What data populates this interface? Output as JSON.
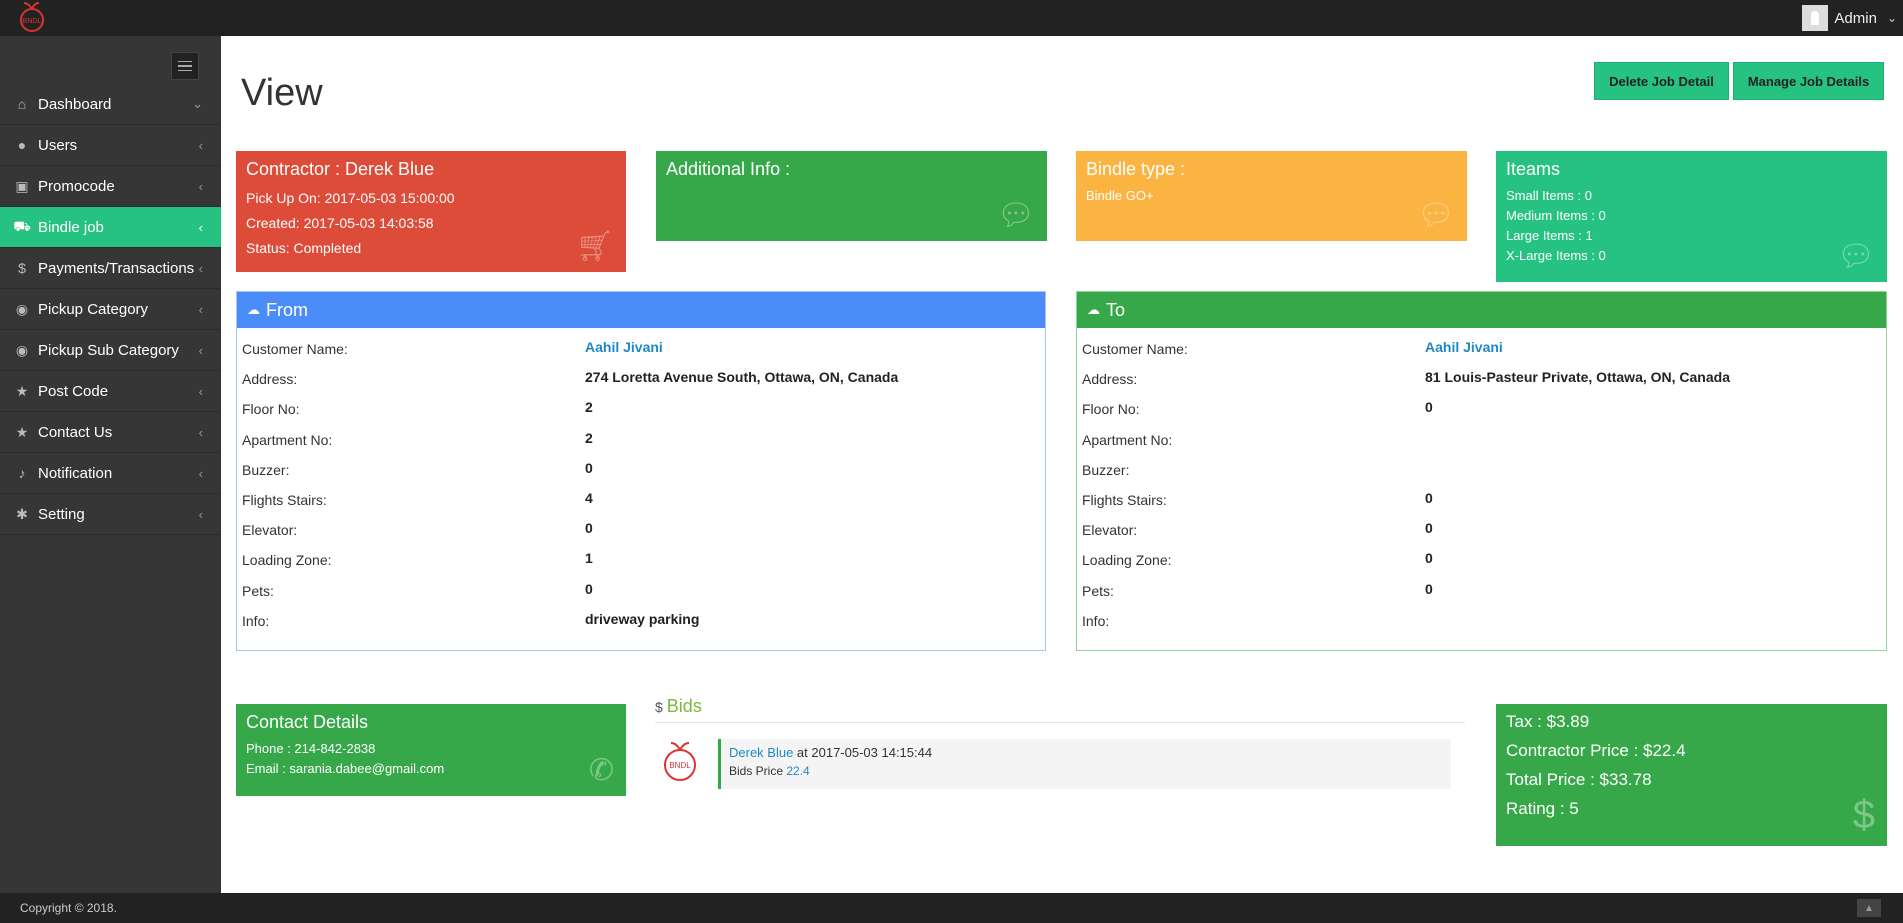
{
  "header": {
    "user": "Admin"
  },
  "sidebar": {
    "items": [
      {
        "icon": "home-icon",
        "glyph": "⌂",
        "label": "Dashboard",
        "arrow": "⌄"
      },
      {
        "icon": "user-icon",
        "glyph": "●",
        "label": "Users",
        "arrow": "‹"
      },
      {
        "icon": "gift-icon",
        "glyph": "▣",
        "label": "Promocode",
        "arrow": "‹"
      },
      {
        "icon": "cart-icon",
        "glyph": "⛟",
        "label": "Bindle job",
        "arrow": "‹",
        "active": true
      },
      {
        "icon": "dollar-icon",
        "glyph": "$",
        "label": "Payments/Transactions",
        "arrow": "‹"
      },
      {
        "icon": "globe-icon",
        "glyph": "◉",
        "label": "Pickup Category",
        "arrow": "‹"
      },
      {
        "icon": "globe-icon",
        "glyph": "◉",
        "label": "Pickup Sub Category",
        "arrow": "‹"
      },
      {
        "icon": "star-icon",
        "glyph": "★",
        "label": "Post Code",
        "arrow": "‹"
      },
      {
        "icon": "star-icon",
        "glyph": "★",
        "label": "Contact Us",
        "arrow": "‹"
      },
      {
        "icon": "bell-icon",
        "glyph": "♪",
        "label": "Notification",
        "arrow": "‹"
      },
      {
        "icon": "gear-icon",
        "glyph": "✱",
        "label": "Setting",
        "arrow": "‹"
      }
    ]
  },
  "page": {
    "title": "View"
  },
  "actions": {
    "delete": "Delete Job Detail",
    "manage": "Manage Job Details"
  },
  "cards": {
    "contractor": {
      "title": "Contractor : Derek Blue",
      "pickup": "Pick Up On: 2017-05-03 15:00:00",
      "created": "Created: 2017-05-03 14:03:58",
      "status": "Status: Completed",
      "color": "#dd4b39"
    },
    "additional": {
      "title": "Additional Info :",
      "color": "#37a84a"
    },
    "bindle": {
      "title": "Bindle type :",
      "value": "Bindle GO+",
      "color": "#fbb442"
    },
    "items": {
      "title": "Iteams",
      "small": "Small Items : 0",
      "medium": "Medium Items : 0",
      "large": "Large Items : 1",
      "xlarge": "X-Large Items : 0",
      "color": "#26c281"
    }
  },
  "from": {
    "title": "From",
    "header_color": "#4b8df8",
    "rows": [
      {
        "k": "Customer Name:",
        "v": "Aahil Jivani",
        "link": true
      },
      {
        "k": "Address:",
        "v": "274 Loretta Avenue South, Ottawa, ON, Canada"
      },
      {
        "k": "Floor No:",
        "v": "2"
      },
      {
        "k": "Apartment No:",
        "v": "2"
      },
      {
        "k": "Buzzer:",
        "v": "0"
      },
      {
        "k": "Flights Stairs:",
        "v": "4"
      },
      {
        "k": "Elevator:",
        "v": "0"
      },
      {
        "k": "Loading Zone:",
        "v": "1"
      },
      {
        "k": "Pets:",
        "v": "0"
      },
      {
        "k": "Info:",
        "v": "driveway parking"
      }
    ]
  },
  "to": {
    "title": "To",
    "header_color": "#37a84a",
    "rows": [
      {
        "k": "Customer Name:",
        "v": "Aahil Jivani",
        "link": true
      },
      {
        "k": "Address:",
        "v": "81 Louis-Pasteur Private, Ottawa, ON, Canada"
      },
      {
        "k": "Floor No:",
        "v": "0"
      },
      {
        "k": "Apartment No:",
        "v": ""
      },
      {
        "k": "Buzzer:",
        "v": ""
      },
      {
        "k": "Flights Stairs:",
        "v": "0"
      },
      {
        "k": "Elevator:",
        "v": "0"
      },
      {
        "k": "Loading Zone:",
        "v": "0"
      },
      {
        "k": "Pets:",
        "v": "0"
      },
      {
        "k": "Info:",
        "v": ""
      }
    ]
  },
  "contact": {
    "title": "Contact Details",
    "phone": "Phone : 214-842-2838",
    "email": "Email : sarania.dabee@gmail.com"
  },
  "bids": {
    "title": "Bids",
    "icon": "$",
    "name": "Derek Blue",
    "at": " at 2017-05-03 14:15:44",
    "price_label": "Bids Price ",
    "price": "22.4"
  },
  "totals": {
    "tax": "Tax : $3.89",
    "contractor": "Contractor Price : $22.4",
    "total": "Total Price : $33.78",
    "rating": "Rating : 5"
  },
  "footer": {
    "copyright": "Copyright © 2018."
  }
}
